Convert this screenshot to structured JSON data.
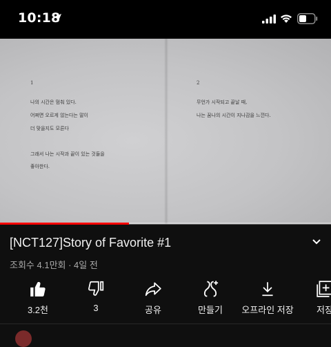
{
  "status_bar": {
    "time": "10:18"
  },
  "video": {
    "progress": 0.39,
    "left_page": {
      "number": "1",
      "lines": [
        "나의 시간은 멈춰 있다.",
        "어쩌면 오르게 않는다는 말이",
        "더 맞을지도 모른다",
        "",
        "그래서 나는 시작과 끝이 있는 것들을",
        "좋아한다."
      ]
    },
    "right_page": {
      "number": "2",
      "lines": [
        "무언가 시작되고 끝날 때,",
        "나는 꿈나의 시간이 지나감을 느낀다."
      ]
    }
  },
  "info": {
    "title": "[NCT127]Story of Favorite #1",
    "meta": "조회수 4.1만회 · 4일 전"
  },
  "actions": {
    "like": "3.2천",
    "dislike": "3",
    "share": "공유",
    "create": "만들기",
    "offline_save": "오프라인 저장",
    "save": "저장"
  },
  "colors": {
    "progress": "#ff0000",
    "background": "#0f0f0f"
  }
}
